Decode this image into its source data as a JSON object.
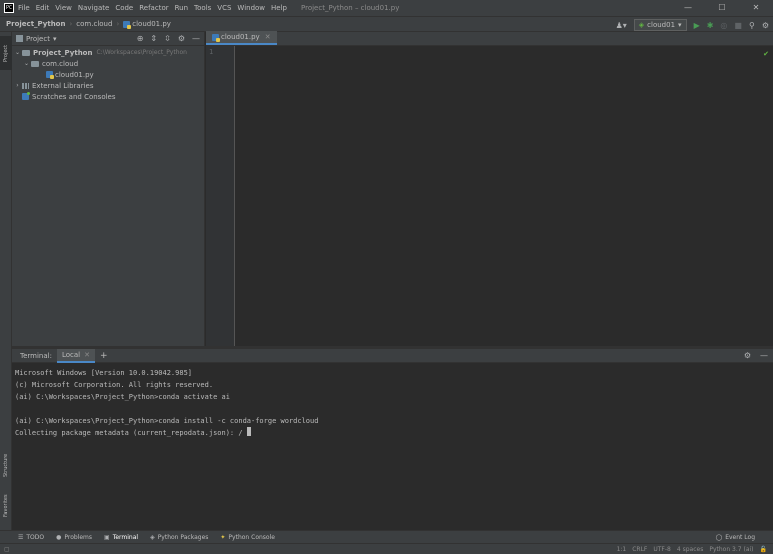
{
  "window": {
    "app_icon_label": "PC",
    "title": "Project_Python – cloud01.py",
    "menu": [
      "File",
      "Edit",
      "View",
      "Navigate",
      "Code",
      "Refactor",
      "Run",
      "Tools",
      "VCS",
      "Window",
      "Help"
    ],
    "controls": {
      "minimize": "—",
      "maximize": "☐",
      "close": "✕"
    }
  },
  "navbar": {
    "breadcrumbs": [
      "Project_Python",
      "com.cloud",
      "cloud01.py"
    ],
    "run_config": "cloud01"
  },
  "left_strip": {
    "tabs": [
      "Project",
      "Structure",
      "Favorites"
    ]
  },
  "project_panel": {
    "header": "Project",
    "tree": {
      "root_name": "Project_Python",
      "root_path": "C:\\Workspaces\\Project_Python",
      "package": "com.cloud",
      "file": "cloud01.py",
      "external": "External Libraries",
      "scratches": "Scratches and Consoles"
    }
  },
  "editor": {
    "tab": "cloud01.py",
    "line_numbers": [
      "1"
    ]
  },
  "terminal": {
    "header": "Terminal:",
    "tab": "Local",
    "lines": [
      "Microsoft Windows [Version 10.0.19042.985]",
      "(c) Microsoft Corporation. All rights reserved.",
      "(ai) C:\\Workspaces\\Project_Python>conda activate ai",
      "",
      "(ai) C:\\Workspaces\\Project_Python>conda install -c conda-forge wordcloud",
      "Collecting package metadata (current_repodata.json): / "
    ]
  },
  "bottom_tabs": {
    "items": [
      "TODO",
      "Problems",
      "Terminal",
      "Python Packages",
      "Python Console"
    ],
    "event_log": "Event Log"
  },
  "status": {
    "position": "1:1",
    "line_sep": "CRLF",
    "encoding": "UTF-8",
    "indent": "4 spaces",
    "interpreter": "Python 3.7 (ai)"
  },
  "colors": {
    "accent": "#4a88c7",
    "run_green": "#499c54",
    "background": "#2b2b2b",
    "panel": "#3c3f41"
  }
}
